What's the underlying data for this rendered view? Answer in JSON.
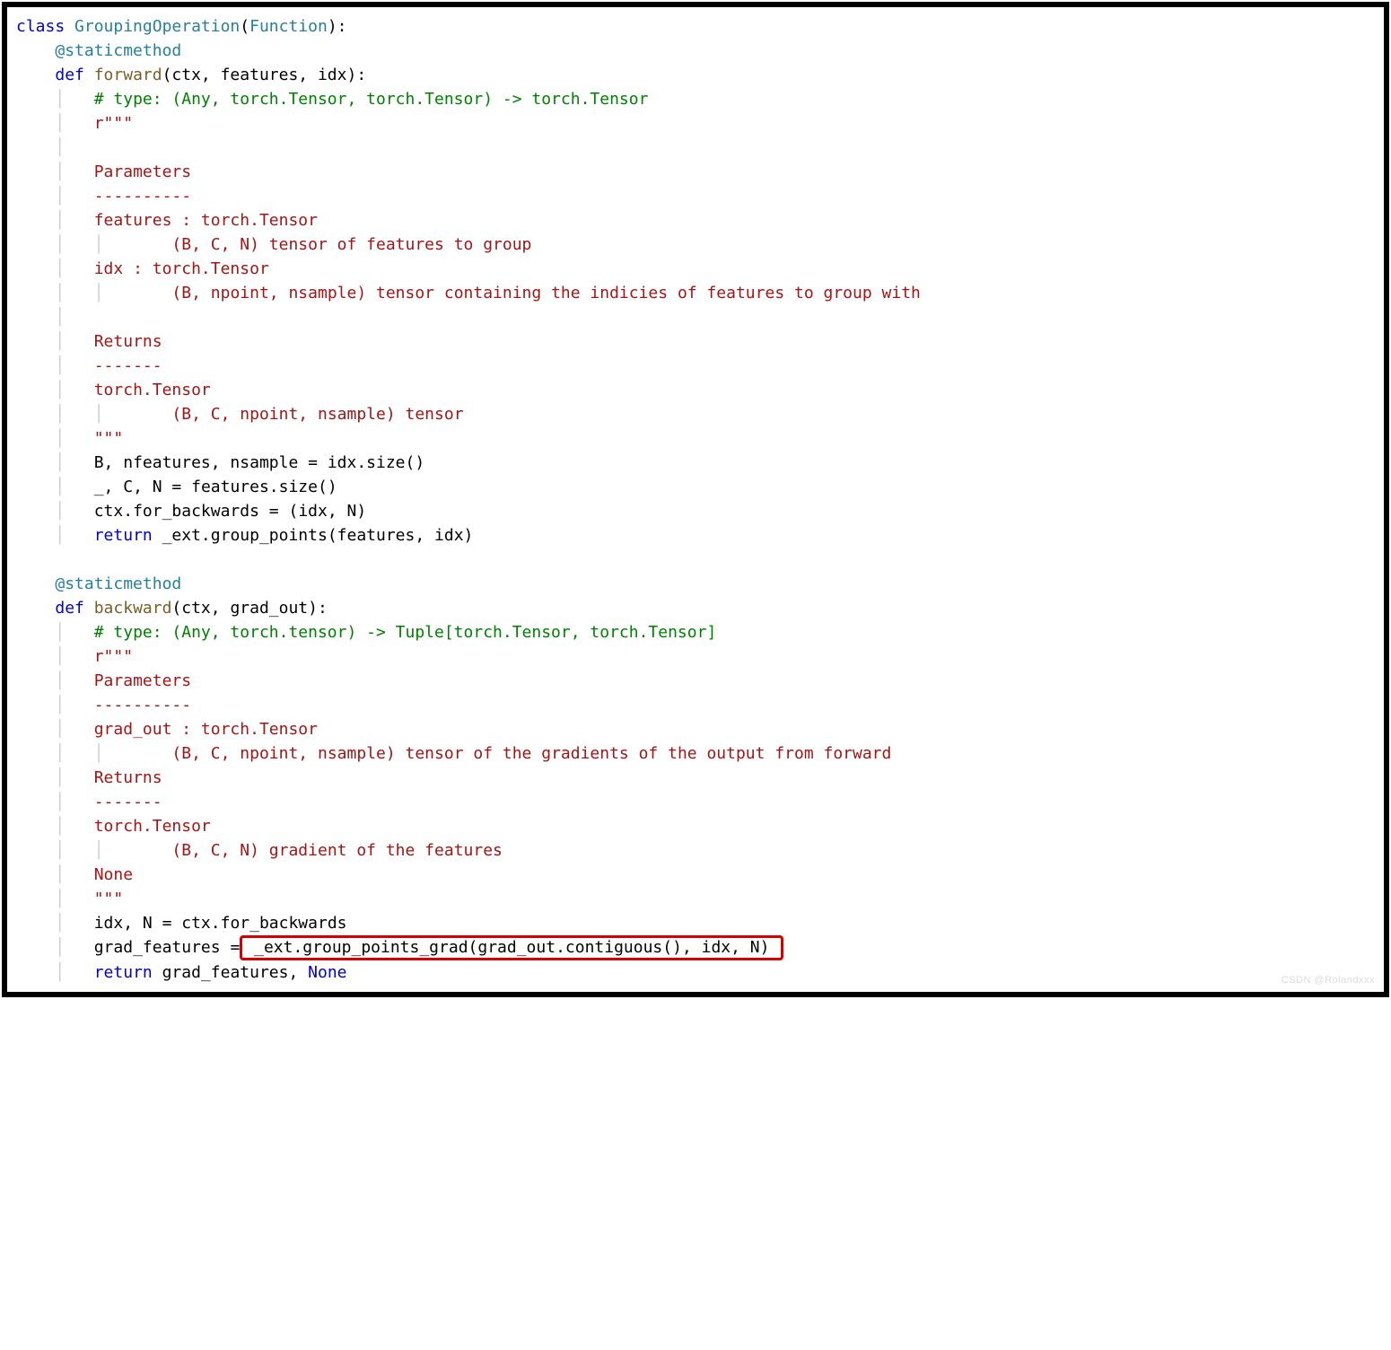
{
  "code": {
    "l1_class": "class",
    "l1_name": "GroupingOperation",
    "l1_paren_open": "(",
    "l1_base": "Function",
    "l1_paren_close": "):",
    "l2_dec": "@staticmethod",
    "l3_def": "def",
    "l3_name": "forward",
    "l3_sig": "(ctx, features, idx):",
    "l4_comment": "# type: (Any, torch.Tensor, torch.Tensor) -> torch.Tensor",
    "l5": "r\"\"\"",
    "l6": "",
    "l7": "Parameters",
    "l8": "----------",
    "l9": "features : torch.Tensor",
    "l10": "    (B, C, N) tensor of features to group",
    "l11": "idx : torch.Tensor",
    "l12": "    (B, npoint, nsample) tensor containing the indicies of features to group with",
    "l13": "",
    "l14": "Returns",
    "l15": "-------",
    "l16": "torch.Tensor",
    "l17": "    (B, C, npoint, nsample) tensor",
    "l18": "\"\"\"",
    "l19_a": "B, nfeatures, nsample ",
    "l19_b": "=",
    "l19_c": " idx.size()",
    "l20_a": "_, C, N ",
    "l20_b": "=",
    "l20_c": " features.size()",
    "l21_a": "ctx.for_backwards ",
    "l21_b": "=",
    "l21_c": " (idx, N)",
    "l22_ret": "return",
    "l22_rest": " _ext.group_points(features, idx)",
    "l23": "",
    "l24_dec": "@staticmethod",
    "l25_def": "def",
    "l25_name": "backward",
    "l25_sig": "(ctx, grad_out):",
    "l26_comment": "# type: (Any, torch.tensor) -> Tuple[torch.Tensor, torch.Tensor]",
    "l27": "r\"\"\"",
    "l28": "Parameters",
    "l29": "----------",
    "l30": "grad_out : torch.Tensor",
    "l31": "    (B, C, npoint, nsample) tensor of the gradients of the output from forward",
    "l32": "Returns",
    "l33": "-------",
    "l34": "torch.Tensor",
    "l35": "    (B, C, N) gradient of the features",
    "l36": "None",
    "l37": "\"\"\"",
    "l38_a": "idx, N ",
    "l38_b": "=",
    "l38_c": " ctx.for_backwards",
    "l39_a": "grad_features ",
    "l39_b": "=",
    "l39_hl": " _ext.group_points_grad(grad_out.contiguous(), idx, N) ",
    "l40_ret": "return",
    "l40_rest": " grad_features, ",
    "l40_none": "None"
  },
  "watermark": "CSDN @Rolandxxx"
}
